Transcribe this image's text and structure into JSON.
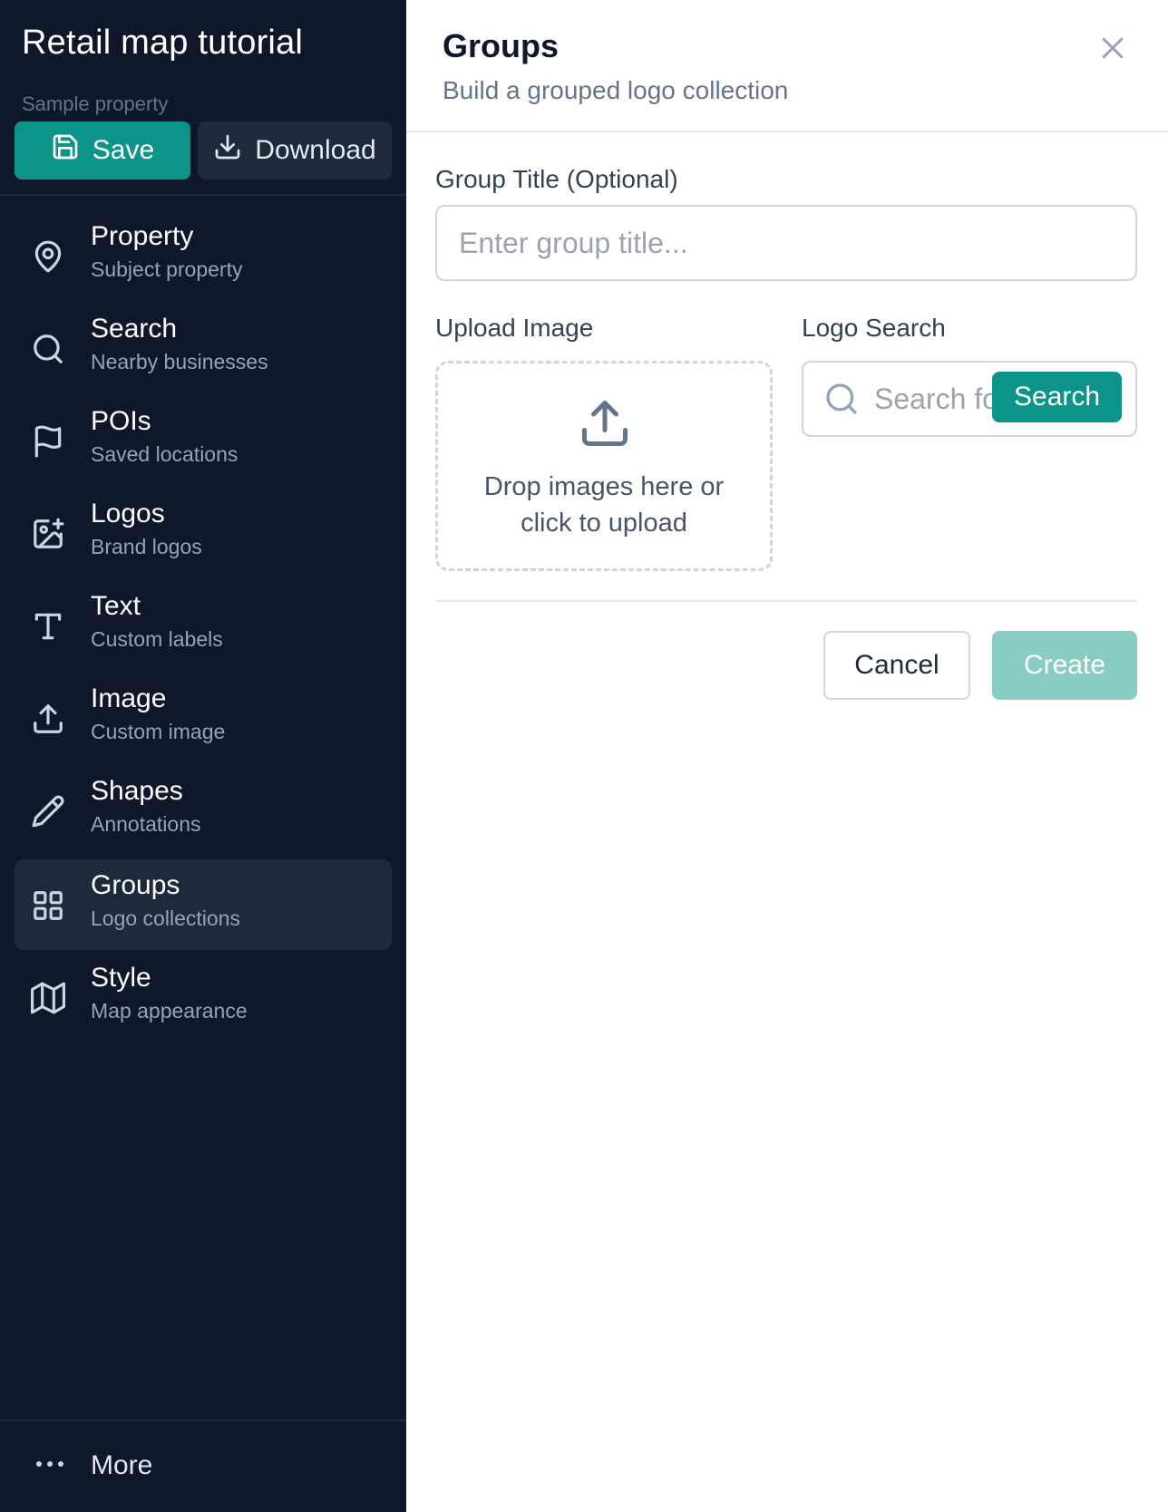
{
  "app": {
    "title": "Retail map tutorial",
    "property_name": "Sample property"
  },
  "toolbar": {
    "save_label": "Save",
    "save_icon": "save-icon",
    "download_label": "Download",
    "download_icon": "download-icon"
  },
  "sidebar": {
    "items": [
      {
        "label": "Property",
        "sub": "Subject property",
        "icon": "map-pin-icon"
      },
      {
        "label": "Search",
        "sub": "Nearby businesses",
        "icon": "search-icon"
      },
      {
        "label": "POIs",
        "sub": "Saved locations",
        "icon": "flag-icon"
      },
      {
        "label": "Logos",
        "sub": "Brand logos",
        "icon": "image-plus-icon"
      },
      {
        "label": "Text",
        "sub": "Custom labels",
        "icon": "type-icon"
      },
      {
        "label": "Image",
        "sub": "Custom image",
        "icon": "upload-icon"
      },
      {
        "label": "Shapes",
        "sub": "Annotations",
        "icon": "pencil-icon"
      },
      {
        "label": "Groups",
        "sub": "Logo collections",
        "icon": "grid-icon",
        "active": true
      },
      {
        "label": "Style",
        "sub": "Map appearance",
        "icon": "map-icon"
      }
    ],
    "more_label": "More"
  },
  "panel": {
    "title": "Groups",
    "subtitle": "Build a grouped logo collection",
    "group_title_label": "Group Title (Optional)",
    "group_title_placeholder": "Enter group title...",
    "group_title_value": "",
    "upload_label": "Upload Image",
    "upload_text": "Drop images here or\nclick to upload",
    "logo_search_label": "Logo Search",
    "logo_search_placeholder": "Search for logos...",
    "search_button": "Search",
    "cancel_label": "Cancel",
    "create_label": "Create"
  },
  "colors": {
    "sidebar_bg": "#0f172a",
    "accent": "#0d9488",
    "accent_disabled": "#88ccc4",
    "active_item_bg": "#1e293b"
  }
}
